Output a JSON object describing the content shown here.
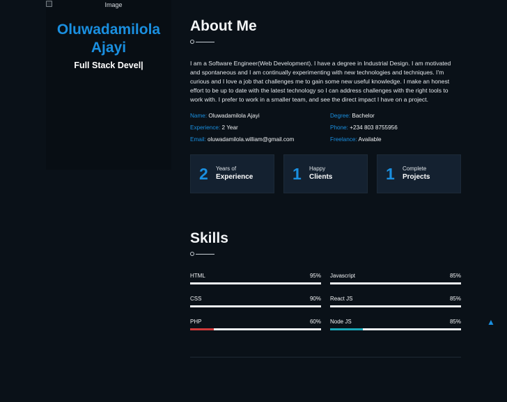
{
  "sidebar": {
    "image_alt": "Image",
    "name_line1": "Oluwadamilola",
    "name_line2": "Ajayi",
    "role": "Full Stack Devel|"
  },
  "about": {
    "title": "About Me",
    "text": "I am a Software Engineer(Web Development). I have a degree in Industrial Design. I am motivated and spontaneous and I am continually experimenting with new technologies and techniques. I'm curious and I love a job that challenges me to gain some new useful knowledge. I make an honest effort to be up to date with the latest technology so I can address challenges with the right tools to work with. I prefer to work in a smaller team, and see the direct impact I have on a project.",
    "info": [
      {
        "key": "Name:",
        "value": "Oluwadamilola Ajayi"
      },
      {
        "key": "Degree:",
        "value": "Bachelor"
      },
      {
        "key": "Experience:",
        "value": "2 Year"
      },
      {
        "key": "Phone:",
        "value": "+234 803 8755956"
      },
      {
        "key": "Email:",
        "value": "oluwadamilola.william@gmail.com"
      },
      {
        "key": "Freelance:",
        "value": "Available"
      }
    ],
    "stats": [
      {
        "number": "2",
        "top": "Years of",
        "bottom": "Experience"
      },
      {
        "number": "1",
        "top": "Happy",
        "bottom": "Clients"
      },
      {
        "number": "1",
        "top": "Complete",
        "bottom": "Projects"
      }
    ]
  },
  "skills": {
    "title": "Skills",
    "items": [
      {
        "name": "HTML",
        "percent_label": "95%",
        "percent": 95,
        "fill_color": "#eef1f3"
      },
      {
        "name": "Javascript",
        "percent_label": "85%",
        "percent": 85,
        "fill_color": "#eef1f3"
      },
      {
        "name": "CSS",
        "percent_label": "90%",
        "percent": 90,
        "fill_color": "#eef1f3"
      },
      {
        "name": "React JS",
        "percent_label": "85%",
        "percent": 85,
        "fill_color": "#eef1f3"
      },
      {
        "name": "PHP",
        "percent_label": "60%",
        "percent": 18,
        "fill_color": "#d03a3a"
      },
      {
        "name": "Node JS",
        "percent_label": "85%",
        "percent": 25,
        "fill_color": "#1aa8b8"
      }
    ]
  },
  "back_to_top_icon": "chevron-up-icon",
  "colors": {
    "accent": "#1a8fe0",
    "background": "#0a1118",
    "card": "#142130"
  }
}
